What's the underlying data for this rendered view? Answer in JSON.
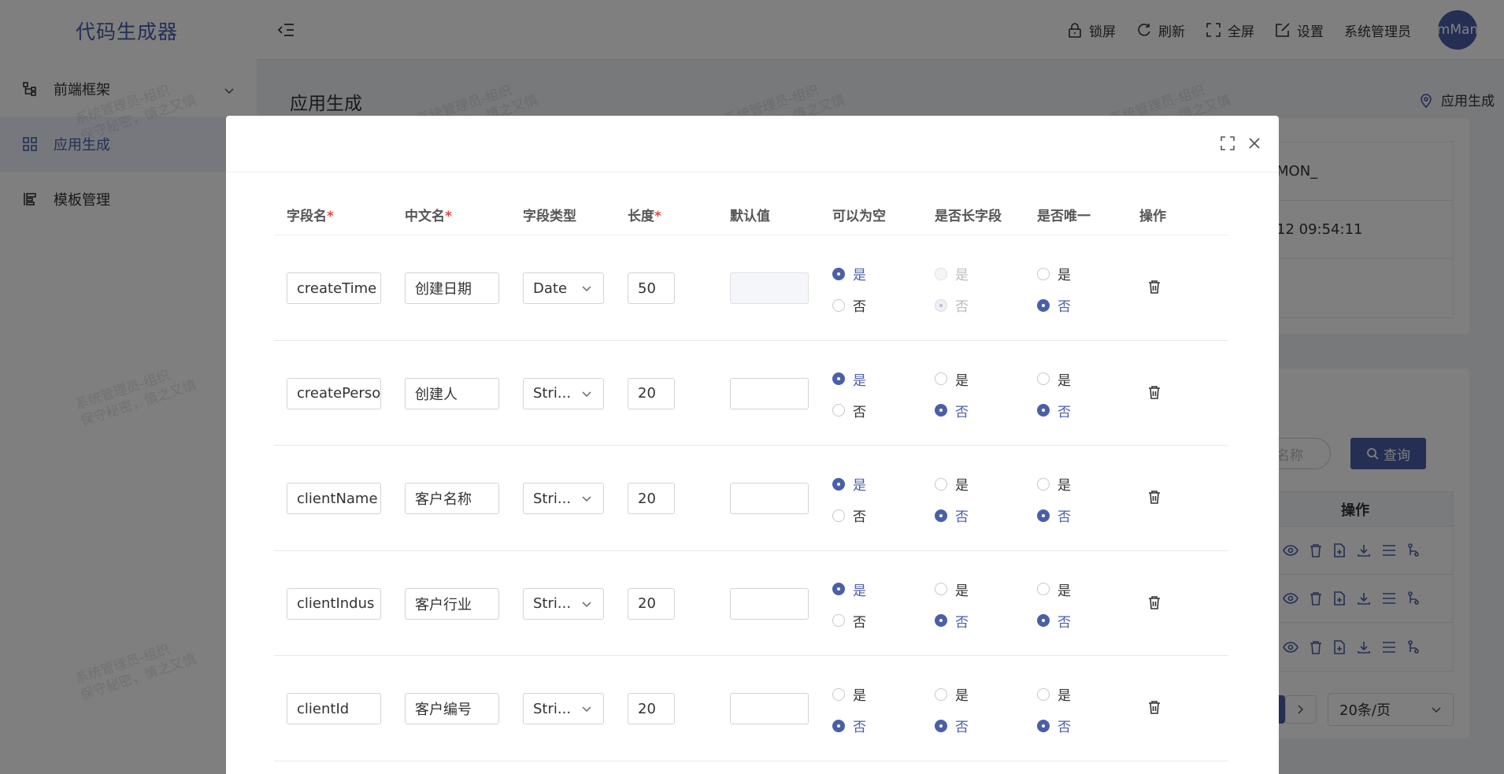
{
  "app": {
    "logo": "代码生成器"
  },
  "sidebar": {
    "items": [
      {
        "label": "前端框架",
        "icon": "tree-icon",
        "expandable": true
      },
      {
        "label": "应用生成",
        "icon": "grid-icon",
        "active": true
      },
      {
        "label": "模板管理",
        "icon": "template-icon"
      }
    ]
  },
  "header": {
    "tools": [
      {
        "label": "锁屏",
        "icon": "lock-icon"
      },
      {
        "label": "刷新",
        "icon": "refresh-icon"
      },
      {
        "label": "全屏",
        "icon": "fullscreen-icon"
      },
      {
        "label": "设置",
        "icon": "edit-icon"
      }
    ],
    "user": "系统管理员",
    "avatar_text": "mMan"
  },
  "page": {
    "title": "应用生成",
    "breadcrumb": "应用生成"
  },
  "background": {
    "info_rows": [
      "MON_",
      "12 09:54:11"
    ],
    "search_placeholder": "名称",
    "query_label": "查询",
    "ops_header": "操作",
    "page_size": "20条/页"
  },
  "watermark": {
    "line1": "系统管理员-组织",
    "line2": "保守秘密，慎之又慎"
  },
  "dialog": {
    "columns": {
      "name": "字段名",
      "cn_name": "中文名",
      "type": "字段类型",
      "length": "长度",
      "default": "默认值",
      "nullable": "可以为空",
      "long_field": "是否长字段",
      "unique": "是否唯一",
      "actions": "操作",
      "required_mark": "*"
    },
    "yes": "是",
    "no": "否",
    "rows": [
      {
        "name": "createTime",
        "cn_name": "创建日期",
        "type": "Date",
        "length": "50",
        "default": "",
        "nullable": true,
        "long_field": false,
        "long_disabled": true,
        "unique": false,
        "default_disabled": true
      },
      {
        "name": "createPerso",
        "cn_name": "创建人",
        "type": "Stri...",
        "length": "20",
        "default": "",
        "nullable": true,
        "long_field": false,
        "long_disabled": false,
        "unique": false,
        "default_disabled": false
      },
      {
        "name": "clientName",
        "cn_name": "客户名称",
        "type": "Stri...",
        "length": "20",
        "default": "",
        "nullable": true,
        "long_field": false,
        "long_disabled": false,
        "unique": false,
        "default_disabled": false
      },
      {
        "name": "clientIndus",
        "cn_name": "客户行业",
        "type": "Stri...",
        "length": "20",
        "default": "",
        "nullable": true,
        "long_field": false,
        "long_disabled": false,
        "unique": false,
        "default_disabled": false
      },
      {
        "name": "clientId",
        "cn_name": "客户编号",
        "type": "Stri...",
        "length": "20",
        "default": "",
        "nullable": false,
        "long_field": false,
        "long_disabled": false,
        "unique": false,
        "default_disabled": false
      }
    ]
  },
  "colors": {
    "primary": "#4a5fa8",
    "required": "#e64545"
  }
}
